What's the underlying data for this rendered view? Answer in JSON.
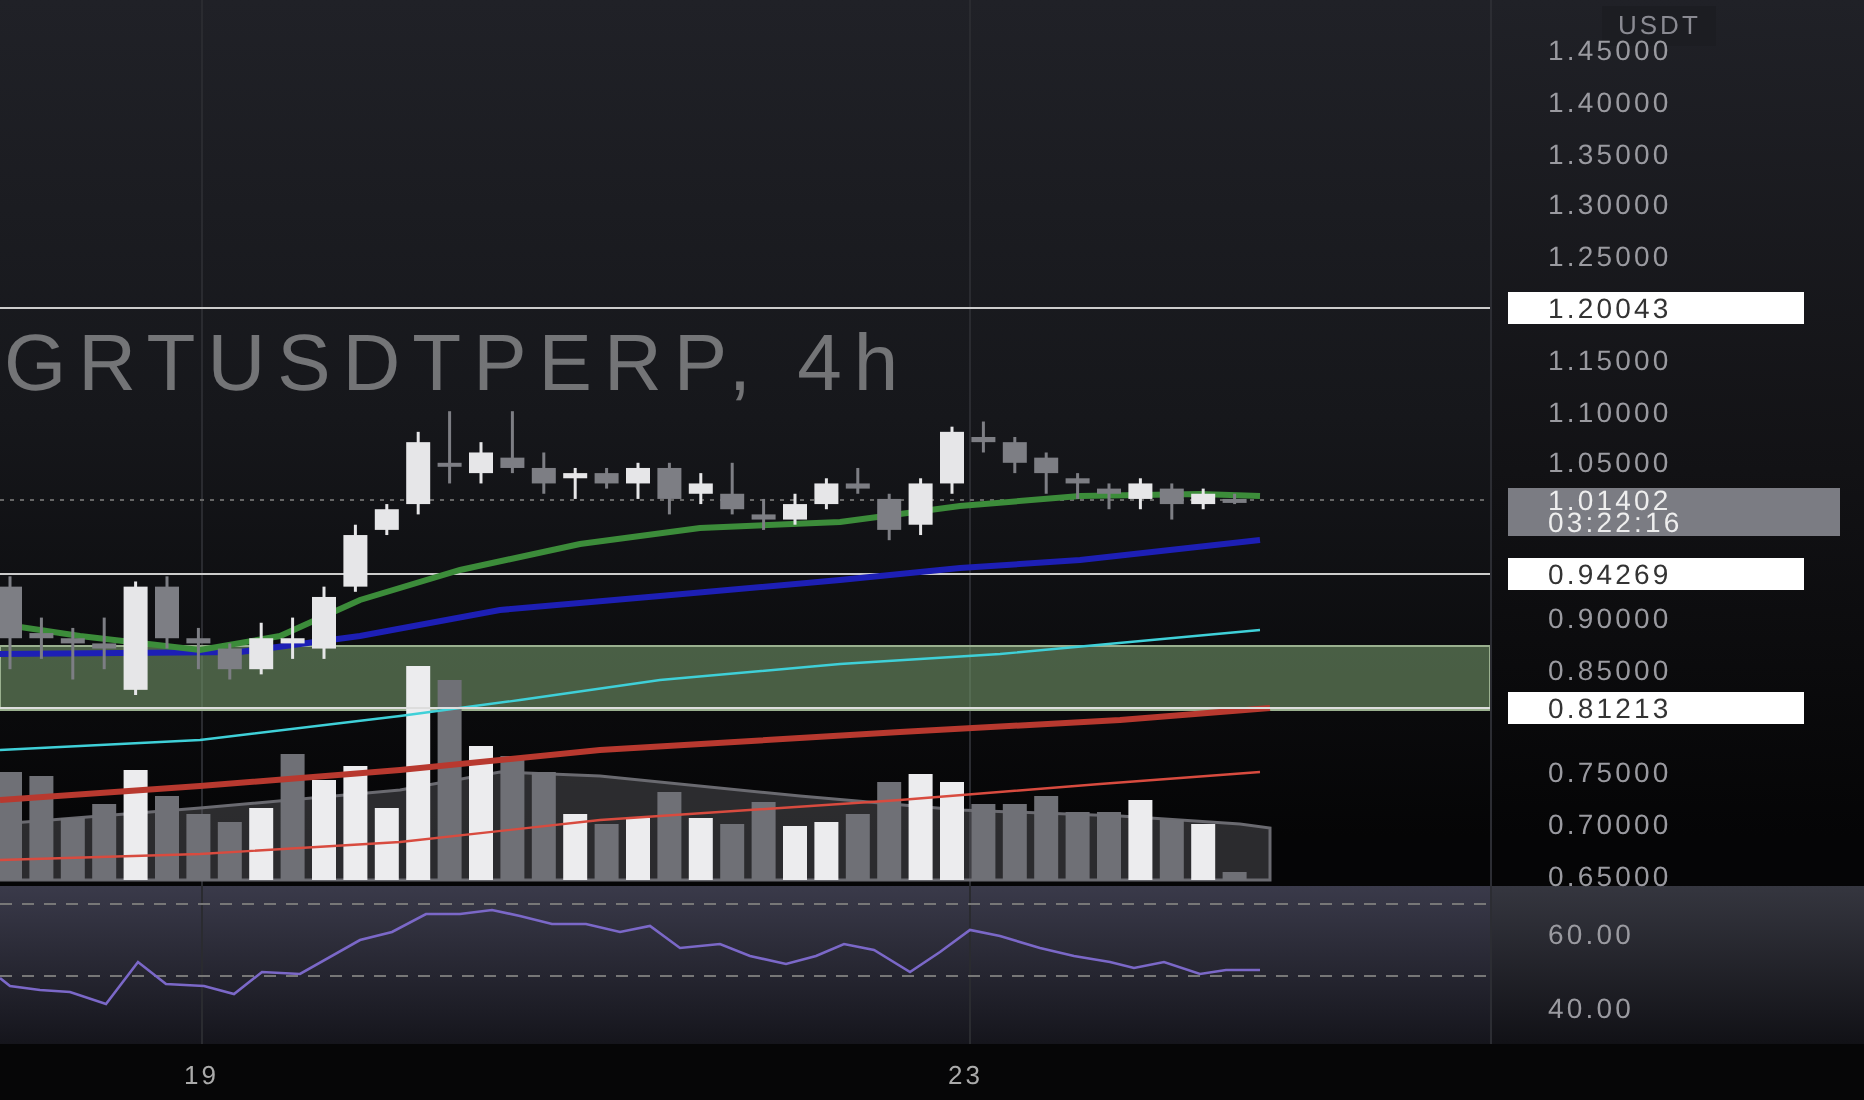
{
  "chart": {
    "watermark": {
      "symbol": "GRTUSDTPERP, 4h"
    },
    "price_axis": {
      "currency": "USDT",
      "ticks": [
        {
          "label": "1.45000"
        },
        {
          "label": "1.40000"
        },
        {
          "label": "1.35000"
        },
        {
          "label": "1.30000"
        },
        {
          "label": "1.25000"
        },
        {
          "label": "1.15000"
        },
        {
          "label": "1.10000"
        },
        {
          "label": "1.05000"
        },
        {
          "label": "0.90000"
        },
        {
          "label": "0.85000"
        },
        {
          "label": "0.75000"
        },
        {
          "label": "0.70000"
        },
        {
          "label": "0.65000"
        }
      ]
    },
    "level_labels": [
      {
        "text": "1.20043"
      },
      {
        "text": "0.94269"
      },
      {
        "text": "0.81213"
      }
    ],
    "last_price": {
      "price": "1.01402",
      "countdown": "03:22:16"
    }
  },
  "rsi": {
    "ticks": [
      {
        "label": "60.00"
      },
      {
        "label": "40.00"
      }
    ]
  },
  "time_axis": {
    "labels": [
      {
        "text": "19"
      },
      {
        "text": "23"
      }
    ]
  }
}
